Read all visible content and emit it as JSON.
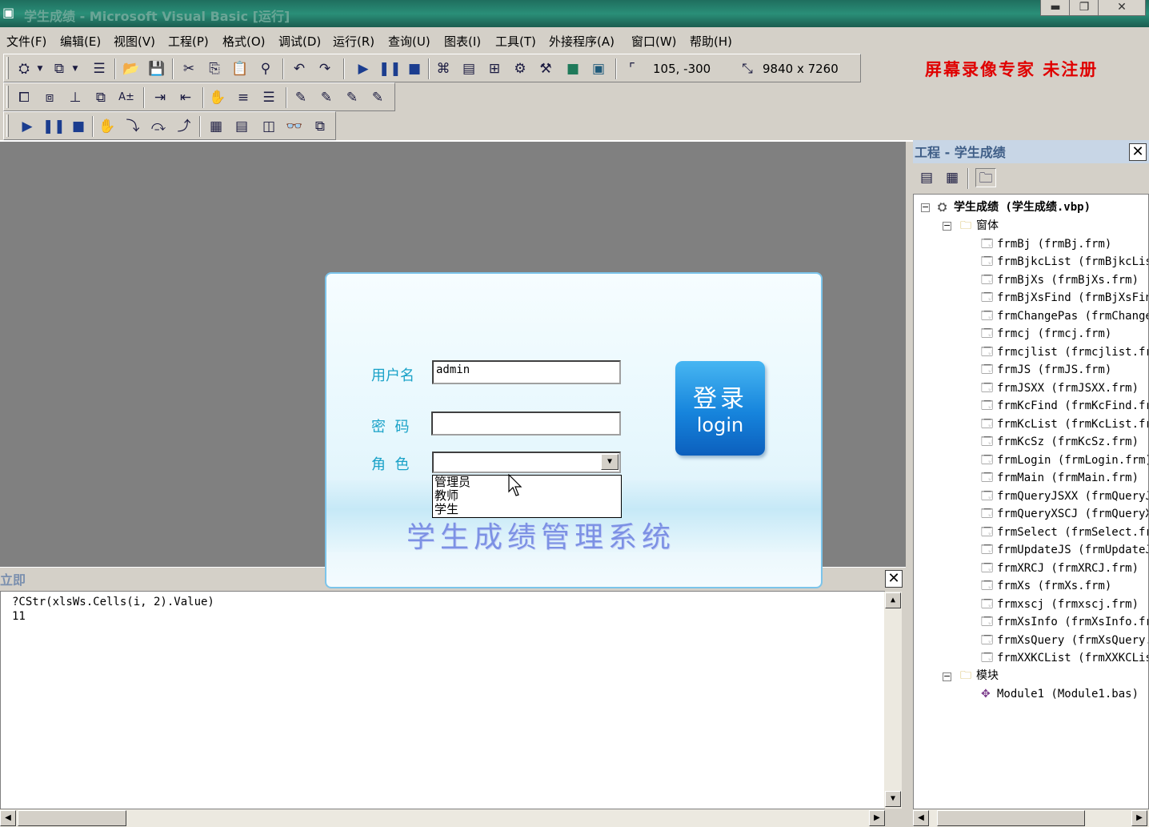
{
  "window": {
    "title": "学生成绩 - Microsoft Visual Basic [运行]",
    "minimize_glyph": "▬",
    "restore_glyph": "❐",
    "close_glyph": "✕"
  },
  "menu": [
    "文件(F)",
    "编辑(E)",
    "视图(V)",
    "工程(P)",
    "格式(O)",
    "调试(D)",
    "运行(R)",
    "查询(U)",
    "图表(I)",
    "工具(T)",
    "外接程序(A)",
    "窗口(W)",
    "帮助(H)"
  ],
  "watermark": "屏幕录像专家  未注册",
  "toolbar": {
    "position_readout": "105, -300",
    "size_readout": "9840 x 7260"
  },
  "immediate": {
    "title": "立即",
    "lines": [
      "?CStr(xlsWs.Cells(i, 2).Value)",
      "11"
    ]
  },
  "project": {
    "title": "工程 - 学生成绩",
    "root": "学生成绩 (学生成绩.vbp)",
    "forms_folder": "窗体",
    "forms": [
      "frmBj (frmBj.frm)",
      "frmBjkcList (frmBjkcList.frm)",
      "frmBjXs (frmBjXs.frm)",
      "frmBjXsFind (frmBjXsFind.frm)",
      "frmChangePas (frmChangePas.frm)",
      "frmcj (frmcj.frm)",
      "frmcjlist (frmcjlist.frm)",
      "frmJS (frmJS.frm)",
      "frmJSXX (frmJSXX.frm)",
      "frmKcFind (frmKcFind.frm)",
      "frmKcList (frmKcList.frm)",
      "frmKcSz (frmKcSz.frm)",
      "frmLogin (frmLogin.frm)",
      "frmMain (frmMain.frm)",
      "frmQueryJSXX (frmQueryJSXX.frm)",
      "frmQueryXSCJ (frmQueryXSCJ.frm)",
      "frmSelect (frmSelect.frm)",
      "frmUpdateJS (frmUpdateJS.frm)",
      "frmXRCJ (frmXRCJ.frm)",
      "frmXs (frmXs.frm)",
      "frmxscj (frmxscj.frm)",
      "frmXsInfo (frmXsInfo.frm)",
      "frmXsQuery (frmXsQuery.frm)",
      "frmXXKCList (frmXXKCList.frm)"
    ],
    "modules_folder": "模块",
    "modules": [
      "Module1 (Module1.bas)"
    ]
  },
  "login": {
    "username_label": "用户名",
    "username_value": "admin",
    "password_label": "密  码",
    "password_value": "",
    "role_label": "角  色",
    "role_value": "",
    "role_options": [
      "管理员",
      "教师",
      "学生"
    ],
    "button_cn": "登录",
    "button_en": "login",
    "system_title": "学生成绩管理系统"
  }
}
